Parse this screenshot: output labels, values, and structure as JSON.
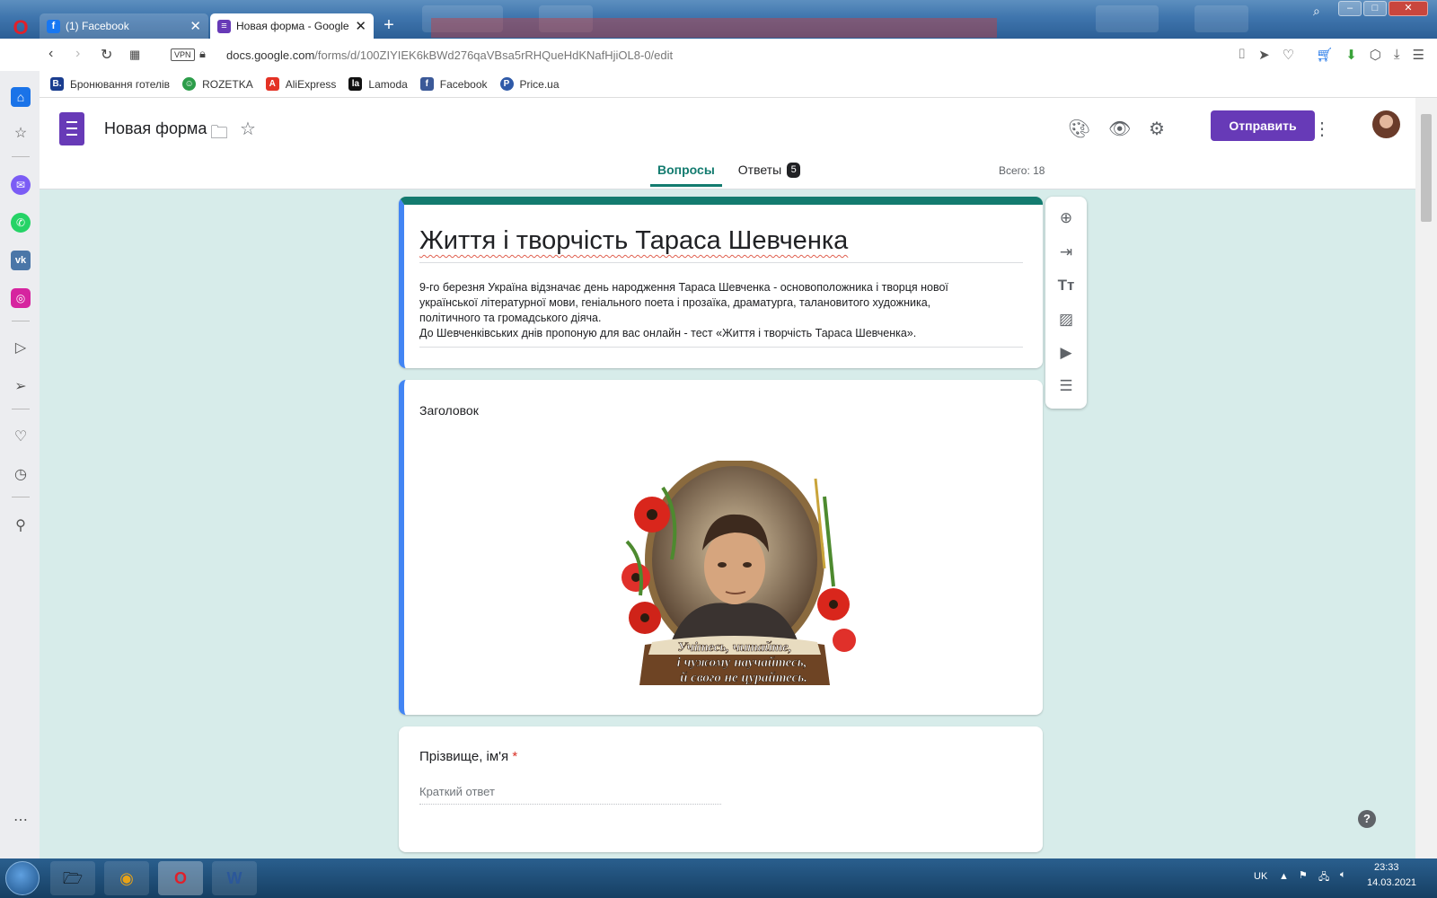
{
  "browser": {
    "tabs": [
      {
        "label": "(1) Facebook",
        "close": "✕"
      },
      {
        "label": "Новая форма - Google Фо",
        "close": "✕"
      }
    ],
    "new_tab": "+",
    "url_prefix": "docs.google.com",
    "url_path": "/forms/d/100ZIYIEK6kBWd276qaVBsa5rRHQueHdKNafHjiOL8-0/edit",
    "vpn_label": "VPN",
    "bookmarks": [
      {
        "label": "Бронювання готелів",
        "icon": "B.",
        "color": "#1a3d8f"
      },
      {
        "label": "ROZETKA",
        "icon": "☺",
        "color": "#2c9d4a"
      },
      {
        "label": "AliExpress",
        "icon": "A",
        "color": "#e43225"
      },
      {
        "label": "Lamoda",
        "icon": "la",
        "color": "#111111"
      },
      {
        "label": "Facebook",
        "icon": "f",
        "color": "#3b5998"
      },
      {
        "label": "Price.ua",
        "icon": "P",
        "color": "#2f5aa8"
      }
    ]
  },
  "form_app": {
    "doc_title": "Новая форма",
    "send_label": "Отправить",
    "tab_questions": "Вопросы",
    "tab_responses": "Ответы",
    "responses_count": "5",
    "total_label": "Всего: 18",
    "accent_color": "#673ab7",
    "theme_color": "#137b6f"
  },
  "form": {
    "title": "Життя і творчість Тараса Шевченка",
    "description_lines": [
      "9-го березня Україна відзначає день народження Тараса Шевченка -  основоположника і творця нової",
      "української літературної мови, геніального поета і прозаїка, драматурга, талановитого художника,",
      "політичного та громадського діяча.",
      "До  Шевченківських днів  пропоную  для вас онлайн - тест «Життя і творчість Тараса Шевченка»."
    ],
    "section_title": "Заголовок",
    "image_caption_lines": [
      "Учітесь, читайте,",
      "і чужому научайтесь,",
      "й свого не цурайтесь."
    ],
    "question": "Прізвище, ім'я",
    "required_mark": "*",
    "answer_placeholder": "Краткий ответ"
  },
  "taskbar": {
    "lang": "UK",
    "time": "23:33",
    "date": "14.03.2021"
  }
}
